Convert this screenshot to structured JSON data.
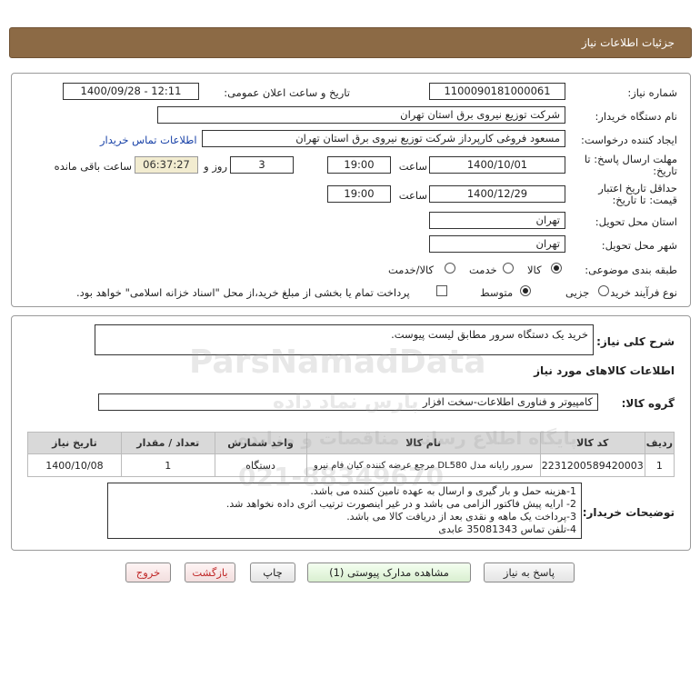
{
  "header": {
    "title": "جزئیات اطلاعات نیاز"
  },
  "need_info": {
    "need_number_label": "شماره نیاز:",
    "need_number": "1100090181000061",
    "announce_label": "تاریخ و ساعت اعلان عمومی:",
    "announce_value": "1400/09/28 - 12:11",
    "buyer_org_label": "نام دستگاه خریدار:",
    "buyer_org": "شرکت توزیع نیروی برق استان تهران",
    "creator_label": "ایجاد کننده درخواست:",
    "creator": "مسعود فروغی کارپرداز شرکت توزیع نیروی برق استان تهران",
    "contact_link": "اطلاعات تماس خریدار",
    "deadline_label_1": "مهلت ارسال پاسخ: تا",
    "deadline_label_2": "تاریخ:",
    "deadline_date": "1400/10/01",
    "time_label": "ساعت",
    "deadline_time": "19:00",
    "days_value": "3",
    "days_label": "روز و",
    "remaining_time": "06:37:27",
    "remaining_label": "ساعت باقی مانده",
    "validity_label_1": "حداقل تاریخ اعتبار",
    "validity_label_2": "قیمت: تا تاریخ:",
    "validity_date": "1400/12/29",
    "validity_time": "19:00",
    "province_label": "استان محل تحویل:",
    "province": "تهران",
    "city_label": "شهر محل تحویل:",
    "city": "تهران",
    "category_label": "طبقه بندی موضوعی:",
    "category_options": [
      "کالا",
      "خدمت",
      "کالا/خدمت"
    ],
    "category_selected": "کالا",
    "process_label": "نوع فرآیند خرید :",
    "process_options": [
      "جزیی",
      "متوسط"
    ],
    "process_selected": "متوسط",
    "payment_note": "پرداخت تمام یا بخشی از مبلغ خرید،از محل \"اسناد خزانه اسلامی\" خواهد بود."
  },
  "description": {
    "label": "شرح کلی نیاز:",
    "value": "خرید یک دستگاه سرور مطابق لیست پیوست."
  },
  "goods": {
    "section_title": "اطلاعات کالاهای مورد نیاز",
    "group_label": "گروه کالا:",
    "group_value": "کامپیوتر و فناوری اطلاعات-سخت افزار",
    "columns": [
      "ردیف",
      "کد کالا",
      "نام کالا",
      "واحد شمارش",
      "تعداد / مقدار",
      "تاریخ نیاز"
    ],
    "rows": [
      [
        "1",
        "2231200589420003",
        "سرور رایانه مدل DL580 مرجع عرضه کننده کیان فام نیرو",
        "دستگاه",
        "1",
        "1400/10/08"
      ]
    ]
  },
  "buyer_notes": {
    "label": "توضیحات خریدار:",
    "lines": [
      "1-هزینه حمل و بار گیری و ارسال به عهده تامین کننده می باشد.",
      "2- ارایه پیش فاکتور الزامی می باشد و در غیر اینصورت ترتیب اثری داده نخواهد شد.",
      "3-پرداخت یک ماهه و نقدی بعد از دریافت کالا می باشد.",
      "4-تلفن تماس 35081343 عابدی"
    ]
  },
  "buttons": {
    "reply": "پاسخ به نیاز",
    "attachments": "مشاهده مدارک پیوستی (1)",
    "print": "چاپ",
    "back": "بازگشت",
    "exit": "خروج"
  },
  "watermark": {
    "brand": "ParsNamadData",
    "line1": "پارس نماد داده",
    "line2": "پایگاه اطلاع رسانی مناقصات و مزایده",
    "phone": "021-88349670"
  },
  "colors": {
    "header_bg": "#8c6a45",
    "time_box_bg": "#f2ecd0",
    "link": "#1a43a8",
    "exit_text": "#c02828"
  }
}
